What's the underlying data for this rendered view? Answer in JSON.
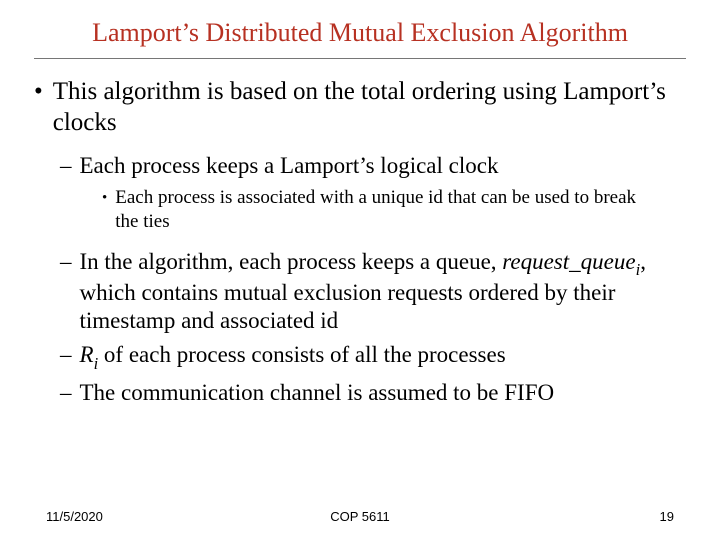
{
  "title": "Lamport’s Distributed Mutual Exclusion Algorithm",
  "top_bullet": "This algorithm is based on the total ordering using Lamport’s clocks",
  "sub1": "Each process keeps a Lamport’s logical clock",
  "sub1_sub": "Each process is associated with a unique id that can be used to break the ties",
  "sub2_prefix": "In the algorithm, each process keeps a queue, ",
  "sub2_var": "request_queue",
  "sub2_sub": "i",
  "sub2_suffix": ", which contains mutual exclusion requests ordered by their timestamp and associated id",
  "sub3_var": "R",
  "sub3_sub": "i",
  "sub3_suffix": " of each process consists of all the processes",
  "sub4": "The communication channel is assumed to be FIFO",
  "footer": {
    "date": "11/5/2020",
    "course": "COP 5611",
    "page": "19"
  }
}
